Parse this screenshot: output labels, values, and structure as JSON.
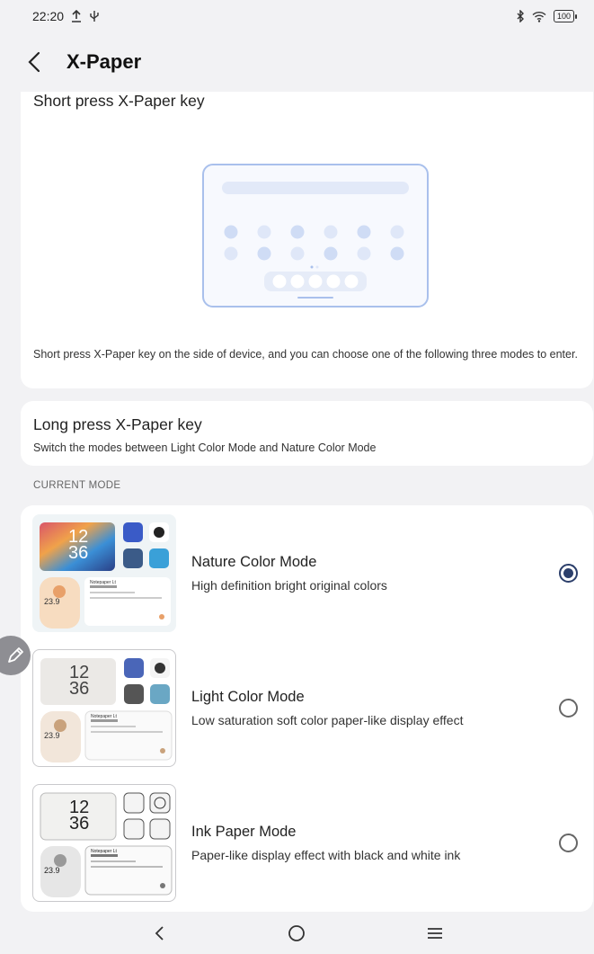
{
  "status_bar": {
    "time": "22:20",
    "battery": "100"
  },
  "header": {
    "title": "X-Paper"
  },
  "short_press": {
    "title": "Short press X-Paper key",
    "description": "Short press X-Paper key on the side of device, and you can choose one of the following three modes to enter."
  },
  "long_press": {
    "title": "Long press X-Paper key",
    "subtitle": "Switch the modes between Light Color Mode and Nature Color Mode"
  },
  "section_label": "CURRENT MODE",
  "thumb": {
    "hour": "12",
    "minute": "36",
    "temp": "23.9",
    "note": "Notepaper Lt"
  },
  "modes": [
    {
      "name": "Nature Color Mode",
      "description": "High definition bright original colors",
      "selected": true
    },
    {
      "name": "Light Color Mode",
      "description": "Low saturation soft color paper-like display effect",
      "selected": false
    },
    {
      "name": "Ink Paper Mode",
      "description": "Paper-like display effect with black and white ink",
      "selected": false
    }
  ],
  "colors": {
    "accent": "#2c3f6b",
    "illustration": "#a9c0ec"
  }
}
